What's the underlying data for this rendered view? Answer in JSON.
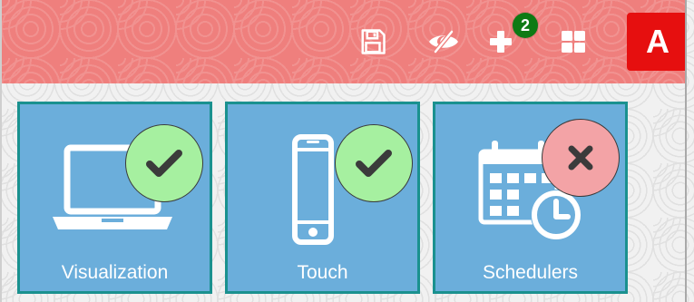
{
  "toolbar": {
    "notification_count": "2",
    "user_initial": "A"
  },
  "icons": [
    "save-icon",
    "hidden-eye-icon",
    "plus-icon",
    "grid-icon",
    "laptop-icon",
    "phone-icon",
    "calendar-clock-icon",
    "check-icon",
    "close-icon"
  ],
  "colors": {
    "topbar": "#ef7f7d",
    "tile": "#6baedb",
    "tile_border": "#1a918f",
    "status_ok": "#a6f0a0",
    "status_bad": "#f3a3a6",
    "badge": "#0e7a14",
    "user_button": "#e60f0f"
  },
  "tiles": [
    {
      "label": "Visualization",
      "status": "enabled"
    },
    {
      "label": "Touch",
      "status": "enabled"
    },
    {
      "label": "Schedulers",
      "status": "disabled"
    }
  ]
}
